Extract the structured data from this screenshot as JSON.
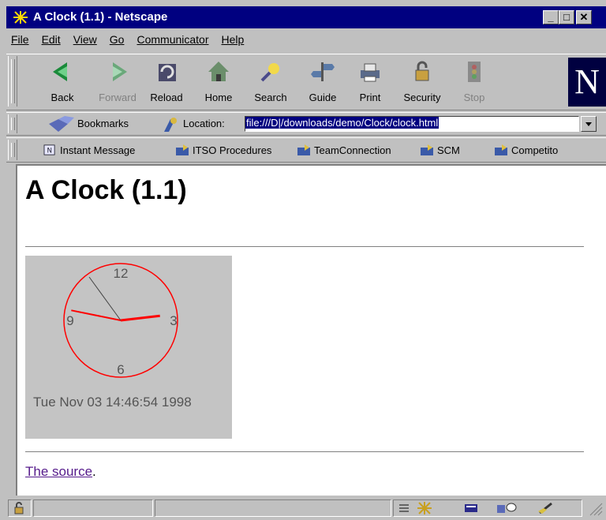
{
  "window": {
    "title": "A Clock (1.1) - Netscape"
  },
  "menu": {
    "items": [
      {
        "label": "File"
      },
      {
        "label": "Edit"
      },
      {
        "label": "View"
      },
      {
        "label": "Go"
      },
      {
        "label": "Communicator"
      },
      {
        "label": "Help"
      }
    ]
  },
  "navigation": {
    "buttons": [
      {
        "label": "Back",
        "icon": "back-arrow-icon",
        "enabled": true
      },
      {
        "label": "Forward",
        "icon": "forward-arrow-icon",
        "enabled": false
      },
      {
        "label": "Reload",
        "icon": "reload-icon",
        "enabled": true
      },
      {
        "label": "Home",
        "icon": "home-icon",
        "enabled": true
      },
      {
        "label": "Search",
        "icon": "search-icon",
        "enabled": true
      },
      {
        "label": "Guide",
        "icon": "guide-icon",
        "enabled": true
      },
      {
        "label": "Print",
        "icon": "print-icon",
        "enabled": true
      },
      {
        "label": "Security",
        "icon": "security-lock-icon",
        "enabled": true
      },
      {
        "label": "Stop",
        "icon": "stop-icon",
        "enabled": false
      }
    ],
    "logo_letter": "N"
  },
  "location": {
    "bookmarks_label": "Bookmarks",
    "label": "Location:",
    "url": "file:///D|/downloads/demo/Clock/clock.html"
  },
  "personal_toolbar": {
    "items": [
      {
        "label": "Instant Message",
        "icon": "instant-message-icon"
      },
      {
        "label": "ITSO Procedures",
        "icon": "folder-icon"
      },
      {
        "label": "TeamConnection",
        "icon": "folder-icon"
      },
      {
        "label": "SCM",
        "icon": "folder-icon"
      },
      {
        "label": "Competito",
        "icon": "folder-icon"
      }
    ]
  },
  "page": {
    "heading": "A Clock (1.1)",
    "clock": {
      "numerals": [
        "12",
        "3",
        "6",
        "9"
      ],
      "date_text": "Tue Nov 03 14:46:54 1998",
      "hours": 14,
      "minutes": 46,
      "seconds": 54
    },
    "source_link": "The source",
    "source_suffix": "."
  },
  "colors": {
    "titlebar": "#000080",
    "chrome": "#c0c0c0",
    "link_visited": "#551a8b",
    "clock_face": "#ff0000",
    "applet_bg": "#c4c4c4"
  }
}
